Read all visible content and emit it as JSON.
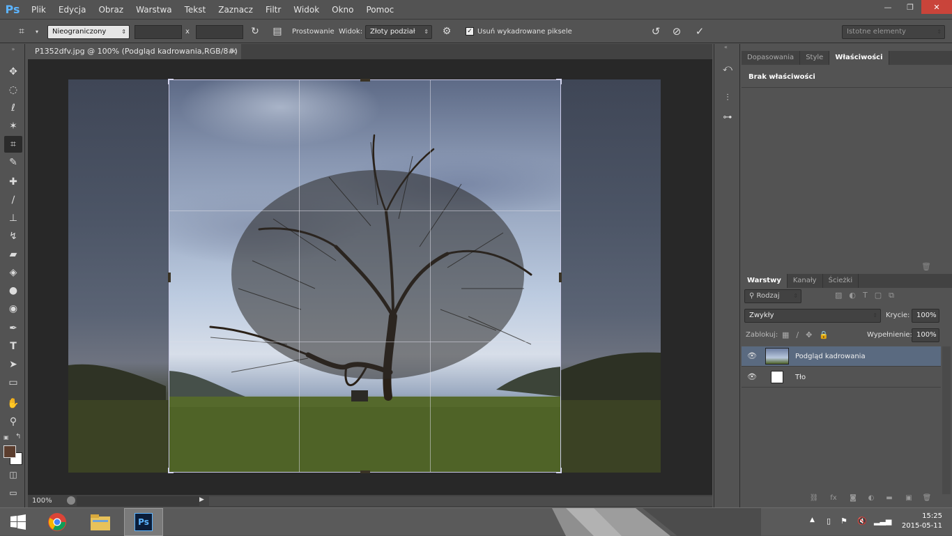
{
  "app": {
    "logo": "Ps"
  },
  "menu": [
    "Plik",
    "Edycja",
    "Obraz",
    "Warstwa",
    "Tekst",
    "Zaznacz",
    "Filtr",
    "Widok",
    "Okno",
    "Pomoc"
  ],
  "window": {
    "minimize": "—",
    "restore": "❐",
    "close": "✕"
  },
  "options": {
    "ratio": "Nieograniczony",
    "ratio_sep": "x",
    "straighten_label": "Prostowanie",
    "view_label": "Widok:",
    "view_value": "Złoty podział",
    "delete_cropped_label": "Usuń wykadrowane piksele",
    "delete_cropped_checked": true,
    "workspace": "Istotne elementy"
  },
  "document": {
    "tab_title": "P1352dfv.jpg @ 100% (Podgląd kadrowania,RGB/8#)",
    "tab_close": "×",
    "zoom": "100%"
  },
  "panels": {
    "top_tabs": [
      "Dopasowania",
      "Style",
      "Właściwości"
    ],
    "top_active": "Właściwości",
    "properties_text": "Brak właściwości",
    "layer_tabs": [
      "Warstwy",
      "Kanały",
      "Ścieżki"
    ],
    "layer_active": "Warstwy",
    "filter_label": "Rodzaj",
    "blend_mode": "Zwykły",
    "opacity_label": "Krycie:",
    "opacity_value": "100%",
    "lock_label": "Zablokuj:",
    "fill_label": "Wypełnienie:",
    "fill_value": "100%",
    "layers": [
      {
        "name": "Podgląd kadrowania",
        "selected": true
      },
      {
        "name": "Tło",
        "selected": false
      }
    ]
  },
  "taskbar": {
    "clock_time": "15:25",
    "clock_date": "2015-05-11",
    "apps": [
      "windows-start",
      "chrome",
      "file-explorer",
      "photoshop"
    ]
  },
  "colors": {
    "foreground": "#5b3d2e",
    "background": "#ffffff",
    "accent": "#5cb4ff"
  }
}
